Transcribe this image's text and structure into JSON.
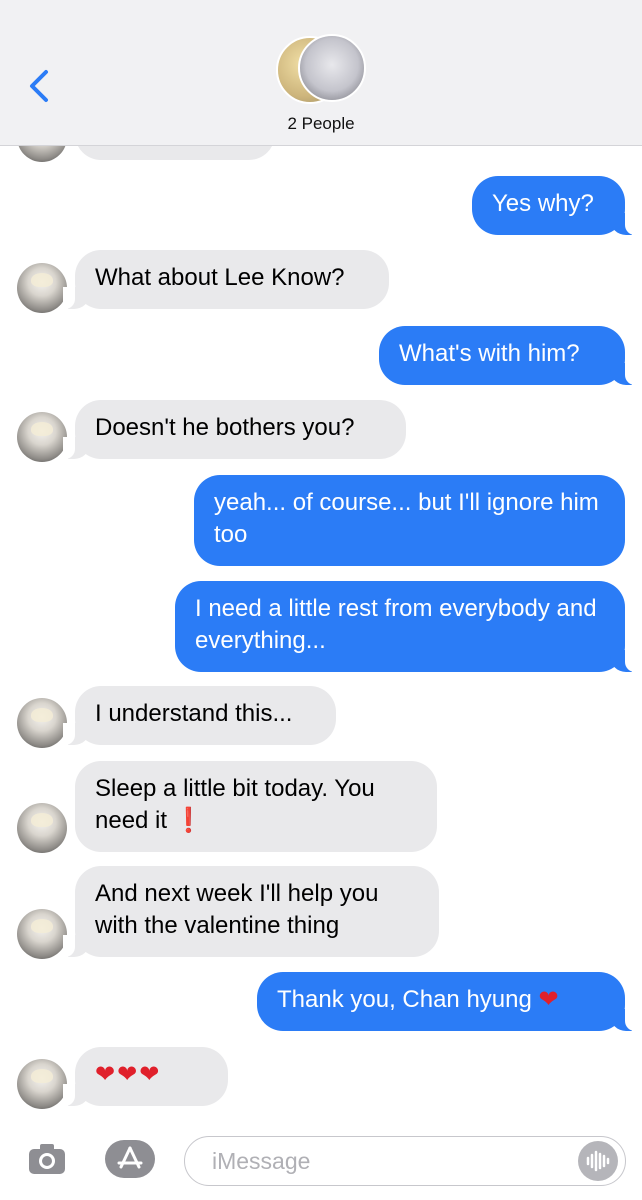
{
  "header": {
    "title": "2 People",
    "back_icon": "chevron-left-icon"
  },
  "messages": [
    {
      "side": "out",
      "text": "Yes why?"
    },
    {
      "side": "in",
      "text": "What about Lee Know?"
    },
    {
      "side": "out",
      "text": "What's with him?"
    },
    {
      "side": "in",
      "text": "Doesn't he bothers you?"
    },
    {
      "side": "out",
      "text": "yeah... of course... but I'll ignore him too"
    },
    {
      "side": "out",
      "text": "I need a little rest from everybody and everything..."
    },
    {
      "side": "in",
      "text": "I understand this..."
    },
    {
      "side": "in",
      "text": "Sleep a little bit today. You need it",
      "emoji": "❗"
    },
    {
      "side": "in",
      "text": "And next week I'll help you with the valentine thing"
    },
    {
      "side": "out",
      "text": "Thank you, Chan hyung",
      "emoji": "❤"
    },
    {
      "side": "in",
      "text": "",
      "emoji": "❤❤❤"
    }
  ],
  "composer": {
    "placeholder": "iMessage",
    "camera_icon": "camera-icon",
    "apps_icon": "app-store-icon",
    "voice_icon": "waveform-icon"
  },
  "colors": {
    "outgoing_bubble": "#2b7cf6",
    "incoming_bubble": "#e9e9eb",
    "accent": "#2b7cf6"
  }
}
